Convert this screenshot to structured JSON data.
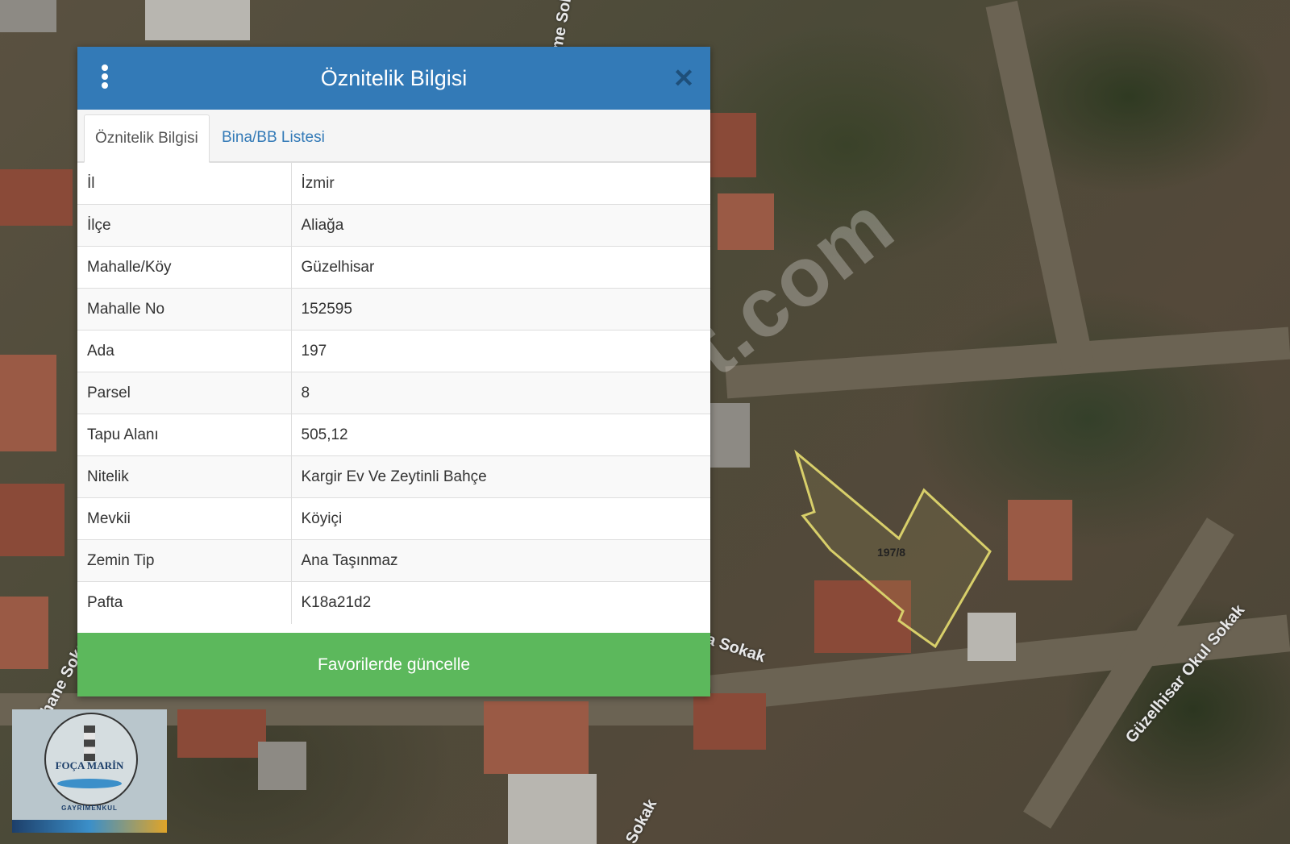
{
  "panel": {
    "title": "Öznitelik Bilgisi",
    "tabs": [
      {
        "label": "Öznitelik Bilgisi",
        "active": true
      },
      {
        "label": "Bina/BB Listesi",
        "active": false
      }
    ],
    "rows": [
      {
        "key": "İl",
        "value": "İzmir"
      },
      {
        "key": "İlçe",
        "value": "Aliağa"
      },
      {
        "key": "Mahalle/Köy",
        "value": "Güzelhisar"
      },
      {
        "key": "Mahalle No",
        "value": "152595"
      },
      {
        "key": "Ada",
        "value": "197"
      },
      {
        "key": "Parsel",
        "value": "8"
      },
      {
        "key": "Tapu Alanı",
        "value": "505,12"
      },
      {
        "key": "Nitelik",
        "value": "Kargir Ev Ve Zeytinli Bahçe"
      },
      {
        "key": "Mevkii",
        "value": "Köyiçi"
      },
      {
        "key": "Zemin Tip",
        "value": "Ana Taşınmaz"
      },
      {
        "key": "Pafta",
        "value": "K18a21d2"
      }
    ],
    "action_label": "Favorilerde güncelle",
    "icons": {
      "menu": "vertical-ellipsis-icon",
      "close": "close-icon"
    }
  },
  "map": {
    "parcel_label": "197/8",
    "streets": [
      "Tabakhane Sokak",
      "Güzelhisar Okul Sokak",
      "a Sokak",
      "Sokak",
      "me Sok"
    ],
    "watermark": "emlakjet.com",
    "colors": {
      "parcel_outline": "#d8cf6a"
    }
  },
  "logo": {
    "name": "FOÇA MARİN",
    "subtitle": "GAYRİMENKUL"
  },
  "colors": {
    "header": "#337ab7",
    "action": "#5cb85c",
    "tab_link": "#337ab7"
  }
}
